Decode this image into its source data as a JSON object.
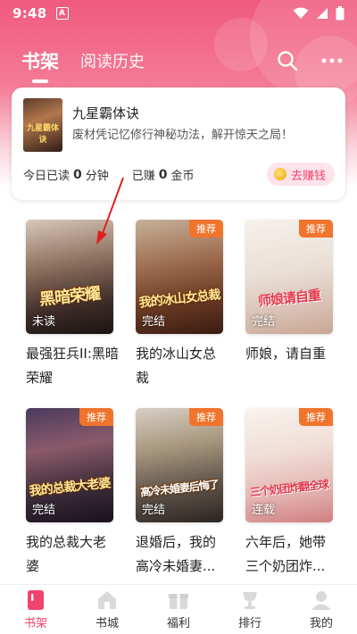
{
  "status_bar": {
    "time": "9:48",
    "notification_icon": "A"
  },
  "top_nav": {
    "tabs": [
      {
        "label": "书架",
        "active": true
      },
      {
        "label": "阅读历史",
        "active": false
      }
    ],
    "icons": [
      "search-icon",
      "more-icon"
    ]
  },
  "reading_card": {
    "book_title": "九星霸体诀",
    "description": "废材凭记忆修行神秘功法，解开惊天之局！",
    "cover_text": "九星霸体诀",
    "today_read_label": "今日已读",
    "today_read_value": "0",
    "today_read_unit": "分钟",
    "earned_label": "已赚",
    "earned_value": "0",
    "earned_unit": "金币",
    "earn_button": "去赚钱"
  },
  "shelf": {
    "books": [
      {
        "title": "最强狂兵II:黑暗荣耀",
        "cover_text": "黑暗荣耀",
        "status": "未读",
        "badge": ""
      },
      {
        "title": "我的冰山女总裁",
        "cover_text": "我的冰山女总裁",
        "status": "完结",
        "badge": "推荐"
      },
      {
        "title": "师娘，请自重",
        "cover_text": "师娘请自重",
        "status": "完结",
        "badge": "推荐"
      },
      {
        "title": "我的总裁大老婆",
        "cover_text": "我的总裁大老婆",
        "status": "完结",
        "badge": "推荐"
      },
      {
        "title": "退婚后，我的高冷未婚妻...",
        "cover_text": "高冷未婚妻后悔了",
        "status": "完结",
        "badge": "推荐"
      },
      {
        "title": "六年后，她带三个奶团炸...",
        "cover_text": "三个奶团炸翻全球",
        "status": "连载",
        "badge": "推荐"
      }
    ]
  },
  "bottom_nav": {
    "items": [
      {
        "label": "书架",
        "icon": "bookshelf-icon",
        "active": true
      },
      {
        "label": "书城",
        "icon": "bookstore-icon",
        "active": false
      },
      {
        "label": "福利",
        "icon": "gift-icon",
        "active": false
      },
      {
        "label": "排行",
        "icon": "ranking-icon",
        "active": false
      },
      {
        "label": "我的",
        "icon": "profile-icon",
        "active": false
      }
    ]
  },
  "colors": {
    "accent": "#f0436d",
    "header": "#f05a7e",
    "badge": "#f0742c"
  }
}
